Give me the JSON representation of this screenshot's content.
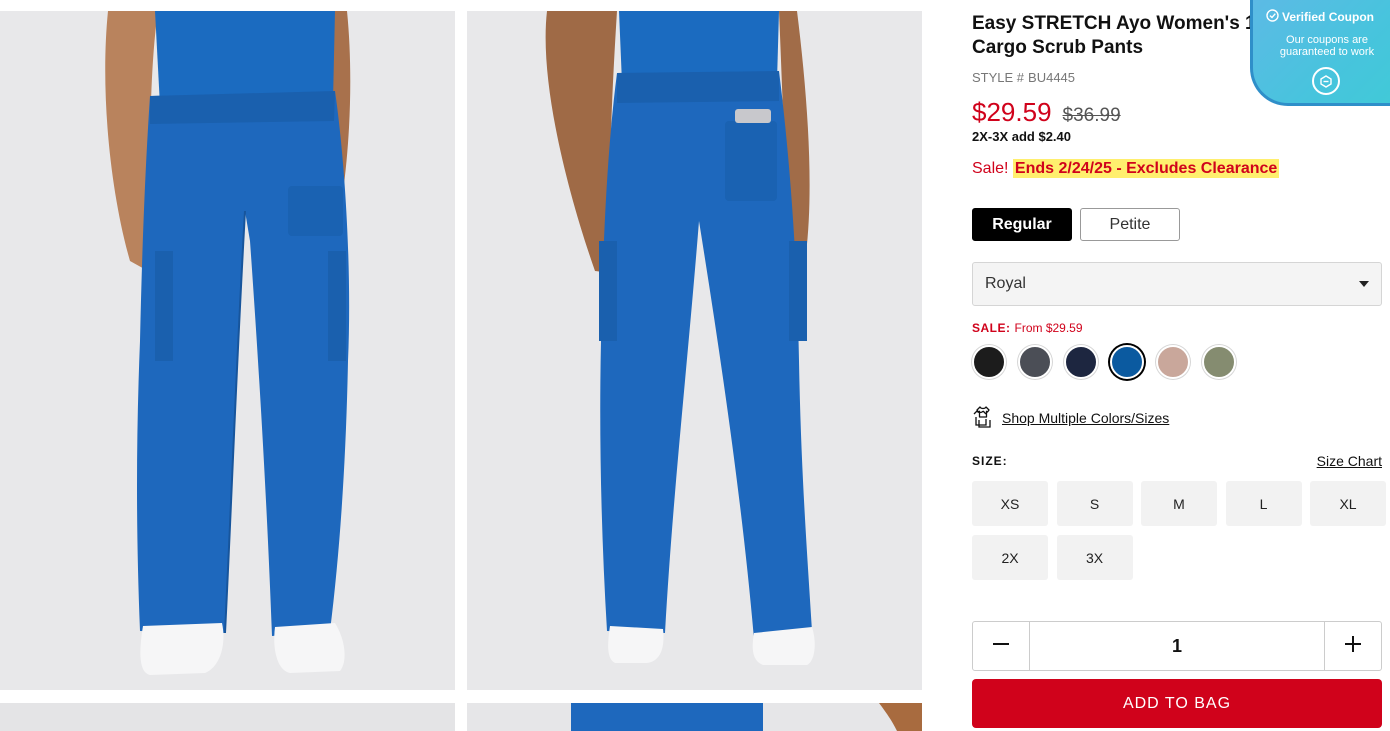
{
  "product": {
    "title": "Easy STRETCH Ayo Women's 10-Pocket Cargo Scrub Pants",
    "style_label": "STYLE #",
    "style_code": "BU4445",
    "price_sale": "$29.59",
    "price_original": "$36.99",
    "upcharge": "2X-3X add $2.40",
    "sale_prefix": "Sale!",
    "sale_highlight": "Ends 2/24/25 - Excludes Clearance"
  },
  "fit": {
    "options": [
      {
        "label": "Regular",
        "selected": true
      },
      {
        "label": "Petite",
        "selected": false
      }
    ]
  },
  "color": {
    "selected": "Royal",
    "sale_label": "SALE:",
    "sale_value": "From $29.59",
    "swatches": [
      {
        "icon": "black-swatch",
        "color": "#1c1c1c"
      },
      {
        "icon": "pewter-swatch",
        "color": "#4b4e56"
      },
      {
        "icon": "navy-swatch",
        "color": "#1d2640"
      },
      {
        "icon": "royal-swatch",
        "color": "#0b5aa0",
        "selected": true
      },
      {
        "icon": "tan-swatch",
        "color": "#c9a79b"
      },
      {
        "icon": "olive-swatch",
        "color": "#858c70"
      }
    ]
  },
  "shop_multi": {
    "icon": "tshirt-stack-icon",
    "label": "Shop Multiple Colors/Sizes"
  },
  "size": {
    "label": "SIZE:",
    "chart_link": "Size Chart",
    "options": [
      "XS",
      "S",
      "M",
      "L",
      "XL",
      "2X",
      "3X"
    ]
  },
  "quantity": {
    "value": "1",
    "minus_icon": "minus-icon",
    "plus_icon": "plus-icon"
  },
  "cta": {
    "add_to_bag": "ADD TO BAG"
  },
  "coupon_widget": {
    "title": "Verified Coupon",
    "subtitle": "Our coupons are guaranteed to work",
    "icon": "coupon-badge-icon"
  },
  "colors": {
    "sale_red": "#d0021b",
    "highlight_yellow": "#ffef6e",
    "pants_royal": "#1e68bd"
  }
}
